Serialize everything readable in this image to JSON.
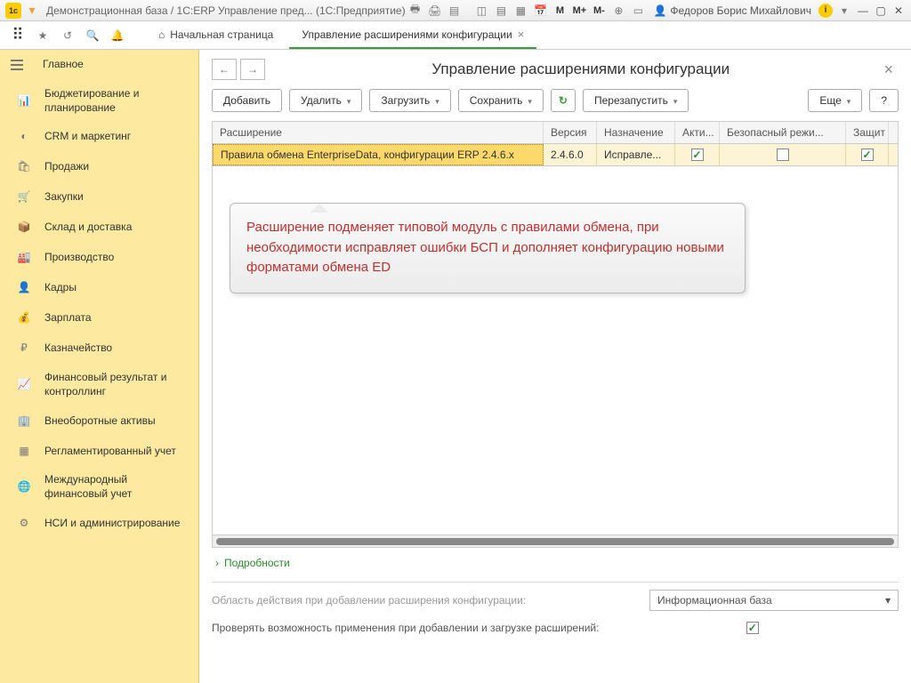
{
  "titlebar": {
    "title": "Демонстрационная база / 1C:ERP Управление пред...  (1С:Предприятие)",
    "user": "Федоров Борис Михайлович"
  },
  "tabs": {
    "home": "Начальная страница",
    "active": "Управление расширениями конфигурации"
  },
  "nav": [
    "Главное",
    "Бюджетирование и планирование",
    "CRM и маркетинг",
    "Продажи",
    "Закупки",
    "Склад и доставка",
    "Производство",
    "Кадры",
    "Зарплата",
    "Казначейство",
    "Финансовый результат и контроллинг",
    "Внеоборотные активы",
    "Регламентированный учет",
    "Международный финансовый учет",
    "НСИ и администрирование"
  ],
  "page": {
    "title": "Управление расширениями конфигурации",
    "buttons": {
      "add": "Добавить",
      "delete": "Удалить",
      "load": "Загрузить",
      "save": "Сохранить",
      "restart": "Перезапустить",
      "more": "Еще",
      "help": "?"
    },
    "columns": {
      "ext": "Расширение",
      "ver": "Версия",
      "naz": "Назначение",
      "akt": "Акти...",
      "bez": "Безопасный режи...",
      "zas": "Защит"
    },
    "row": {
      "ext": "Правила обмена EnterpriseData, конфигурации ERP 2.4.6.x",
      "ver": "2.4.6.0",
      "naz": "Исправле..."
    },
    "tooltip": "Расширение подменяет типовой модуль с правилами обмена, при необходимости исправляет ошибки БСП и дополняет конфигурацию новыми форматами обмена ED",
    "details": "Подробности",
    "scope_label": "Область действия при добавлении расширения конфигурации:",
    "scope_value": "Информационная база",
    "check_label": "Проверять возможность применения при добавлении и загрузке расширений:"
  }
}
